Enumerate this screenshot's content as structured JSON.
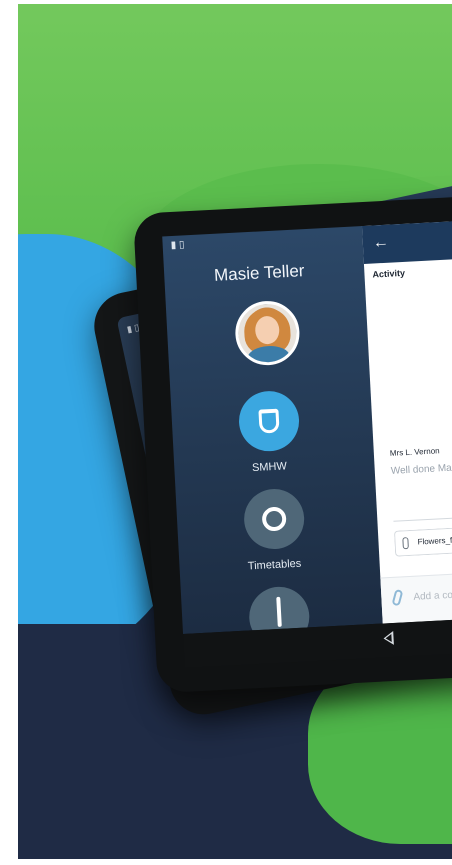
{
  "sidebar": {
    "user_name": "Masie Teller",
    "items": [
      {
        "label": "SMHW",
        "icon": "shield-icon"
      },
      {
        "label": "Timetables",
        "icon": "ring-icon"
      },
      {
        "label": "",
        "icon": "bar-icon"
      }
    ]
  },
  "content": {
    "header_icon": "back-arrow-icon",
    "section_title": "Activity",
    "comment": {
      "author": "Mrs L. Vernon",
      "text": "Well done Ma some notes v"
    },
    "attachment_name": "Flowers_f",
    "add_comment_placeholder": "Add a comm"
  },
  "colors": {
    "accent": "#3ba7e0",
    "sidebar_bg": "#233852",
    "header_bg": "#1d3a5d",
    "background_green": "#5bbd4d",
    "background_blue": "#34a6e3",
    "background_navy": "#1f2b45"
  }
}
